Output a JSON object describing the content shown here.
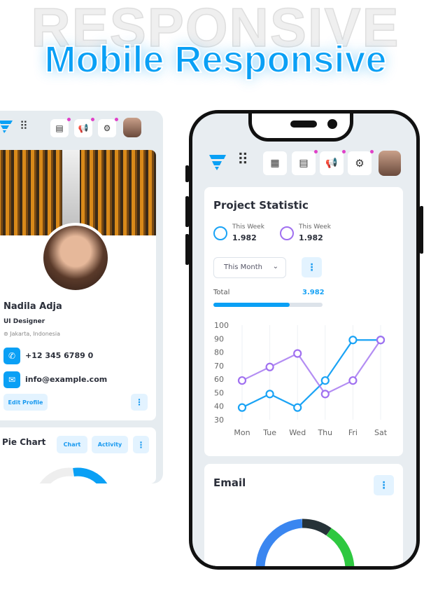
{
  "background_word": "RESPONSIVE",
  "headline": "Mobile Responsive",
  "colors": {
    "accent": "#0aa0f5",
    "purple": "#a070f0",
    "notification": "#e040c8"
  },
  "left_panel": {
    "header_icons": [
      "grid-dots-icon",
      "chat-icon",
      "megaphone-icon",
      "gear-icon"
    ],
    "profile": {
      "name": "Nadila Adja",
      "role": "UI Designer",
      "location": "Jakarta, Indonesia",
      "phone": "+12 345 6789 0",
      "email": "info@example.com",
      "edit_label": "Edit Profile"
    },
    "pie_card": {
      "title": "Pie Chart",
      "tabs": [
        "Chart",
        "Activity"
      ]
    }
  },
  "phone": {
    "header_icons": [
      "grid-dots-icon",
      "dashboard-icon",
      "chat-icon",
      "megaphone-icon",
      "gear-icon"
    ],
    "project": {
      "title": "Project Statistic",
      "legend": [
        {
          "label": "This Week",
          "value": "1.982"
        },
        {
          "label": "This Week",
          "value": "1.982"
        }
      ],
      "period": "This Month",
      "total_label": "Total",
      "total_value": "3.982",
      "progress_percent": 70
    },
    "email_card": {
      "title": "Email"
    }
  },
  "chart_data": {
    "type": "line",
    "categories": [
      "Mon",
      "Tue",
      "Wed",
      "Thu",
      "Fri",
      "Sat"
    ],
    "yticks": [
      30,
      40,
      50,
      60,
      70,
      80,
      90,
      100
    ],
    "ylim": [
      30,
      100
    ],
    "grid": "vertical",
    "series": [
      {
        "color": "#1aa3f5",
        "values": [
          39,
          49,
          39,
          59,
          89,
          89
        ]
      },
      {
        "color": "#a070f0",
        "values": [
          59,
          69,
          79,
          49,
          59,
          89
        ]
      }
    ]
  }
}
